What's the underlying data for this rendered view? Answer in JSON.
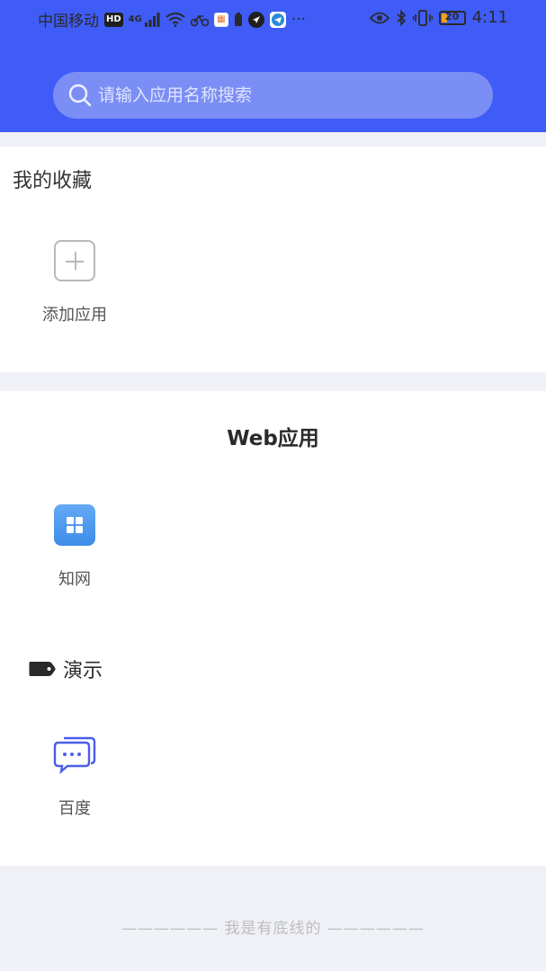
{
  "status_bar": {
    "carrier": "中国移动",
    "hd_badge": "HD",
    "network": "4G",
    "battery_level": "20",
    "time": "4:11",
    "more": "···"
  },
  "search": {
    "placeholder": "请输入应用名称搜索"
  },
  "favorites": {
    "title": "我的收藏",
    "add_label": "添加应用"
  },
  "web_apps": {
    "title": "Web应用",
    "apps": [
      {
        "label": "知网",
        "icon": "grid-app-icon"
      }
    ],
    "tag": {
      "label": "演示",
      "icon": "tag-icon",
      "apps": [
        {
          "label": "百度",
          "icon": "chat-bubbles-icon"
        }
      ]
    }
  },
  "footer": {
    "text": "—————— 我是有底线的 ——————"
  },
  "colors": {
    "header": "#3f5cf6",
    "search_bg": "#7b8ef5",
    "background": "#eff1f6",
    "zhiwang_blue": "#4a95ee",
    "chat_icon": "#4a5ee8"
  }
}
